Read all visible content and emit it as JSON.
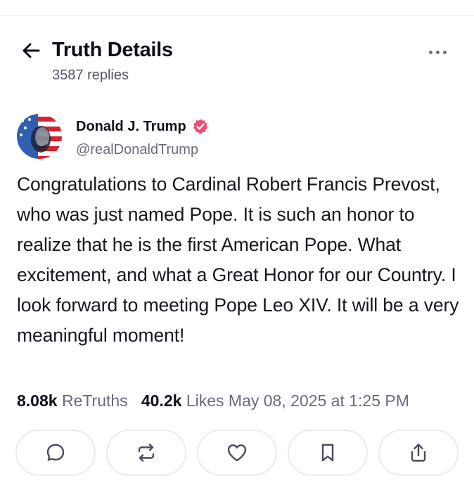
{
  "header": {
    "title": "Truth Details",
    "replies": "3587 replies"
  },
  "author": {
    "name": "Donald J. Trump",
    "handle": "@realDonaldTrump",
    "verified": true,
    "verified_color": "#ef4c76"
  },
  "post": {
    "text": "Congratulations to Cardinal Robert Francis Prevost, who was just named Pope. It is such an honor to realize that he is the first American Pope. What excitement, and what a Great Honor for our Country. I look forward to meeting Pope Leo XIV. It will be a very meaningful moment!"
  },
  "stats": {
    "retruths_count": "8.08k",
    "retruths_label": "ReTruths",
    "likes_count": "40.2k",
    "likes_label": "Likes",
    "timestamp": "May 08, 2025 at 1:25 PM"
  },
  "actions": [
    {
      "icon": "reply-icon"
    },
    {
      "icon": "retruth-icon"
    },
    {
      "icon": "like-icon"
    },
    {
      "icon": "bookmark-icon"
    },
    {
      "icon": "share-icon"
    }
  ],
  "colors": {
    "text": "#0f0e1a",
    "muted": "#6b6a7d",
    "border": "#ebebf0",
    "verified": "#ef4c76"
  }
}
